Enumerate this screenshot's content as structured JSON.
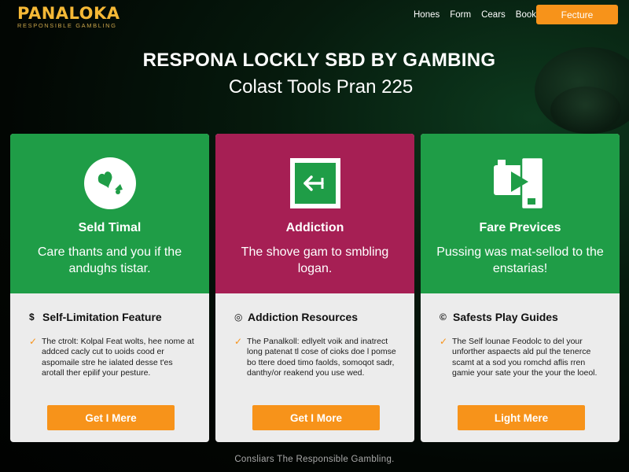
{
  "brand": {
    "name": "PANALOKA",
    "tagline": "RESPONSIBLE GAMBLING"
  },
  "nav": {
    "links": [
      "Hones",
      "Form",
      "Cears",
      "Book"
    ],
    "cta_label": "Fecture"
  },
  "hero": {
    "title": "RESPONA LOCKLY SBD BY GAMBING",
    "subtitle": "Colast Tools Pran 225"
  },
  "cards": [
    {
      "heading": "Seld Timal",
      "description": "Care thants and you if the andughs tistar.",
      "feature_title": "Self-Limitation Feature",
      "feature_text": "The ctrolt: Kolpal Feat wolts, hee nome at addced cacly cut to uoids cood er aspomaile stre he ialated desse t'es arotall ther epilif your pesture.",
      "button_label": "Get I Mere",
      "icon": "chip-spade-icon",
      "color": "#1f9d47"
    },
    {
      "heading": "Addiction",
      "description": "The shove gam to smbling logan.",
      "feature_title": "Addiction Resources",
      "feature_text": "The Panalkoll: edlyelt voik and inatrect long patenat tl cose of cioks doe l pomse bo ttere doed timo faolds, somoqot sadr, danthy/or reakend you use wed.",
      "button_label": "Get I More",
      "icon": "exit-arrow-icon",
      "color": "#a61f54"
    },
    {
      "heading": "Fare Previces",
      "description": "Pussing was mat-sellod to the enstarias!",
      "feature_title": "Safests Play Guides",
      "feature_text": "The Self lounae Feodolc to del your unforther aspaects ald pul the tenerce scamt at a sod you romchd aflis rren gamie your sate your the your the loeol.",
      "button_label": "Light Mere",
      "icon": "play-tablet-icon",
      "color": "#1f9d47"
    }
  ],
  "footer": {
    "text": "Consliars The Responsible Gambling."
  },
  "colors": {
    "accent": "#f7931a",
    "green": "#1f9d47",
    "magenta": "#a61f54",
    "logo": "#f5b836"
  }
}
